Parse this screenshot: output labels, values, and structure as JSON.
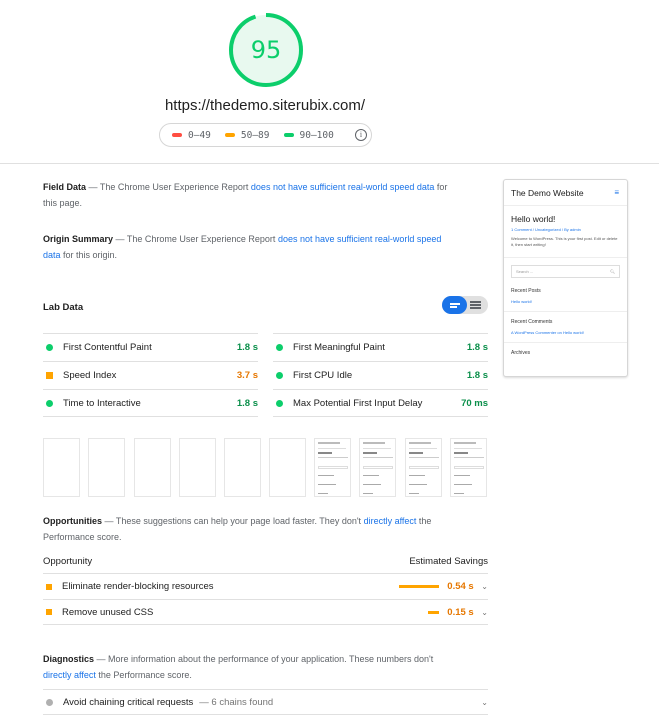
{
  "header": {
    "score": "95",
    "url": "https://thedemo.siterubix.com/",
    "legend": [
      {
        "label": "0–49",
        "color": "#ff4e42"
      },
      {
        "label": "50–89",
        "color": "#ffa400"
      },
      {
        "label": "90–100",
        "color": "#0cce6b"
      }
    ],
    "info_icon": "i"
  },
  "field_data": {
    "title": "Field Data",
    "pre": " — The Chrome User Experience Report ",
    "link": "does not have sufficient real-world speed data",
    "post": " for this page."
  },
  "origin_summary": {
    "title": "Origin Summary",
    "pre": " — The Chrome User Experience Report ",
    "link": "does not have sufficient real-world speed data",
    "post": " for this origin."
  },
  "lab_data": {
    "title": "Lab Data",
    "metrics": [
      {
        "label": "First Contentful Paint",
        "value": "1.8 s",
        "status": "green"
      },
      {
        "label": "First Meaningful Paint",
        "value": "1.8 s",
        "status": "green"
      },
      {
        "label": "Speed Index",
        "value": "3.7 s",
        "status": "orange"
      },
      {
        "label": "First CPU Idle",
        "value": "1.8 s",
        "status": "green"
      },
      {
        "label": "Time to Interactive",
        "value": "1.8 s",
        "status": "green"
      },
      {
        "label": "Max Potential First Input Delay",
        "value": "70 ms",
        "status": "green"
      }
    ]
  },
  "opportunities": {
    "title": "Opportunities",
    "pre": " — These suggestions can help your page load faster. They don't ",
    "link": "directly affect",
    "post": " the Performance score.",
    "col_left": "Opportunity",
    "col_right": "Estimated Savings",
    "items": [
      {
        "label": "Eliminate render-blocking resources",
        "savings": "0.54 s",
        "fraction": 1.0
      },
      {
        "label": "Remove unused CSS",
        "savings": "0.15 s",
        "fraction": 0.28
      }
    ]
  },
  "diagnostics": {
    "title": "Diagnostics",
    "pre": " — More information about the performance of your application. These numbers don't ",
    "link": "directly affect",
    "post": " the Performance score.",
    "items": [
      {
        "label": "Avoid chaining critical requests",
        "detail": "— 6 chains found"
      }
    ]
  },
  "screenshot": {
    "site_title": "The Demo Website",
    "menu_icon": "≡",
    "post_title": "Hello world!",
    "post_meta": "1 Comment / Uncategorized / By admin",
    "post_text": "Welcome to WordPress. This is your first post. Edit or delete it, then start writing!",
    "search_placeholder": "Search ...",
    "search_icon": "🔍︎",
    "recent_posts": "Recent Posts",
    "recent_post_link": "Hello world!",
    "recent_comments": "Recent Comments",
    "recent_comment_link": "A WordPress Commenter on Hello world!",
    "archives": "Archives"
  },
  "colors": {
    "pass": "#0cce6b",
    "average": "#ffa400",
    "fail": "#ff4e42",
    "link": "#1a73e8"
  }
}
